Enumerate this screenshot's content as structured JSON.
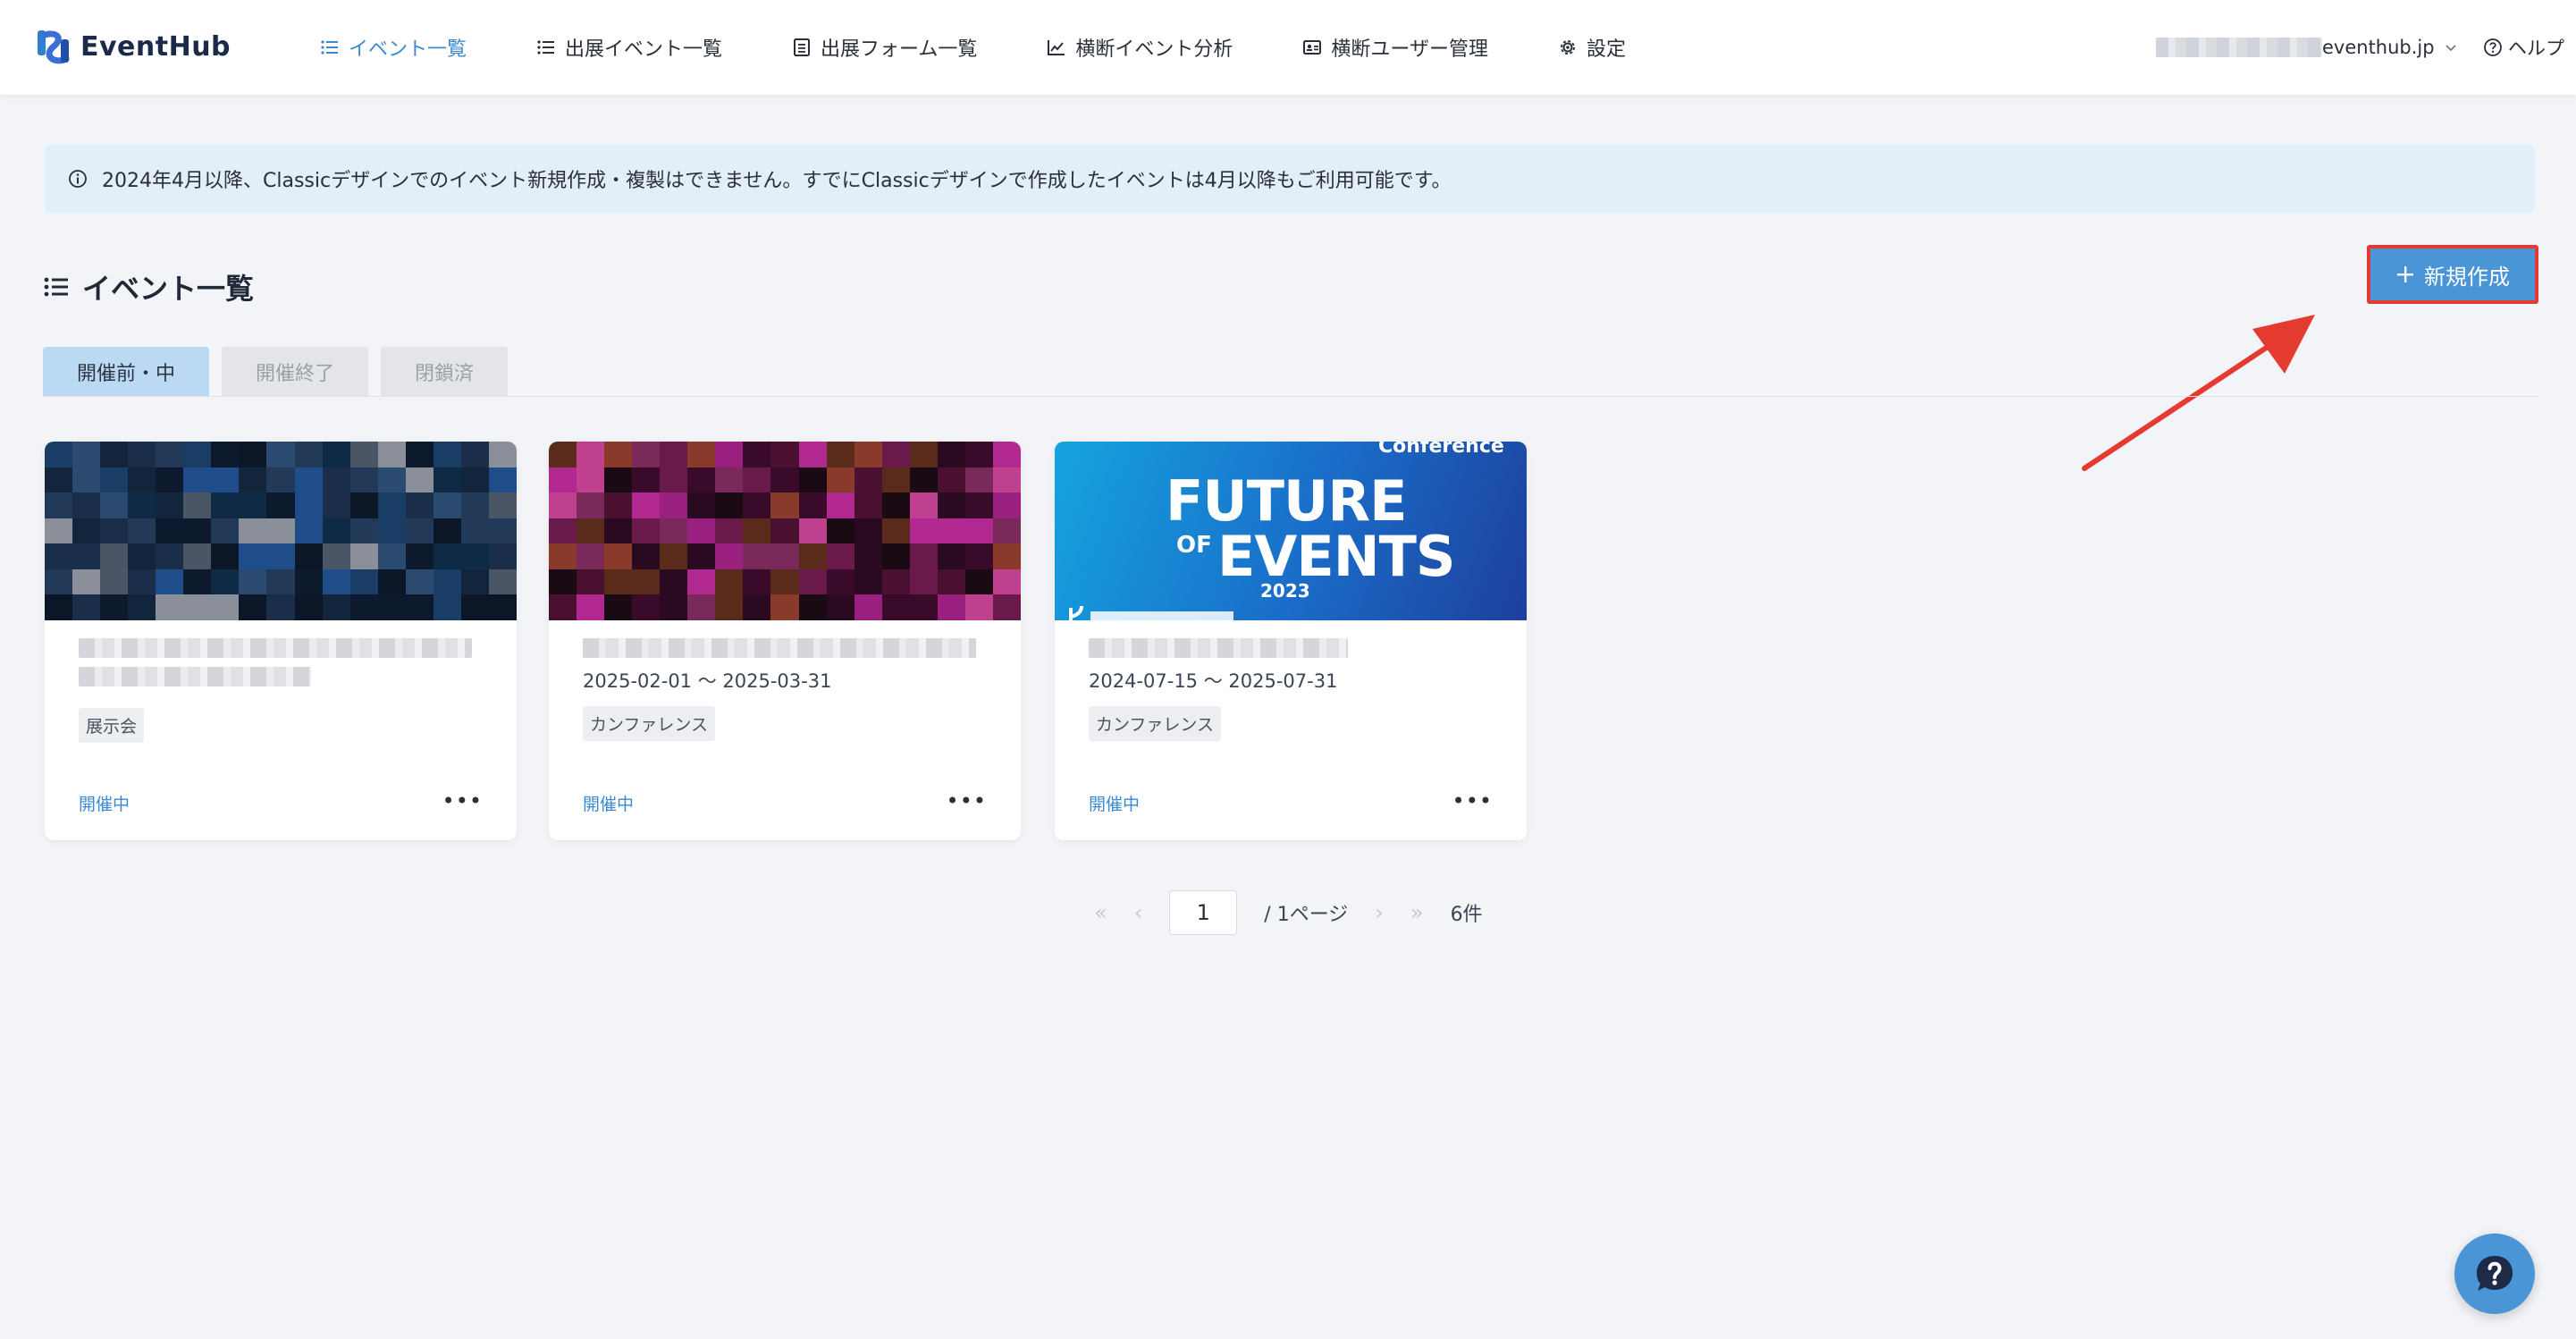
{
  "brand": {
    "name": "EventHub"
  },
  "nav": {
    "items": [
      {
        "label": "イベント一覧",
        "active": true,
        "icon": "list-icon"
      },
      {
        "label": "出展イベント一覧",
        "active": false,
        "icon": "list-icon"
      },
      {
        "label": "出展フォーム一覧",
        "active": false,
        "icon": "form-icon"
      },
      {
        "label": "横断イベント分析",
        "active": false,
        "icon": "chart-icon"
      },
      {
        "label": "横断ユーザー管理",
        "active": false,
        "icon": "id-card-icon"
      },
      {
        "label": "設定",
        "active": false,
        "icon": "gear-icon"
      }
    ],
    "account_suffix": "eventhub.jp",
    "help_label": "ヘルプ"
  },
  "notice": {
    "text": "2024年4月以降、Classicデザインでのイベント新規作成・複製はできません。すでにClassicデザインで作成したイベントは4月以降もご利用可能です。"
  },
  "page": {
    "title": "イベント一覧",
    "new_button_label": "新規作成"
  },
  "tabs": [
    {
      "label": "開催前・中",
      "active": true
    },
    {
      "label": "開催終了",
      "active": false
    },
    {
      "label": "閉鎖済",
      "active": false
    }
  ],
  "cards": [
    {
      "dates": "",
      "tag": "展示会",
      "status": "開催中"
    },
    {
      "dates": "2025-02-01 〜 2025-03-31",
      "tag": "カンファレンス",
      "status": "開催中"
    },
    {
      "dates": "2024-07-15 〜 2025-07-31",
      "tag": "カンファレンス",
      "status": "開催中",
      "banner": {
        "line1": "FUTURE",
        "line2a": "OF",
        "line2b": "EVENTS",
        "year": "2023",
        "top": "Conference"
      }
    }
  ],
  "pagination": {
    "current": "1",
    "total_label": "/ 1ページ",
    "count_label": "6件"
  },
  "colors": {
    "accent": "#4a95d6",
    "highlight": "#e53a2f",
    "nav_active": "#3b8ad0"
  }
}
